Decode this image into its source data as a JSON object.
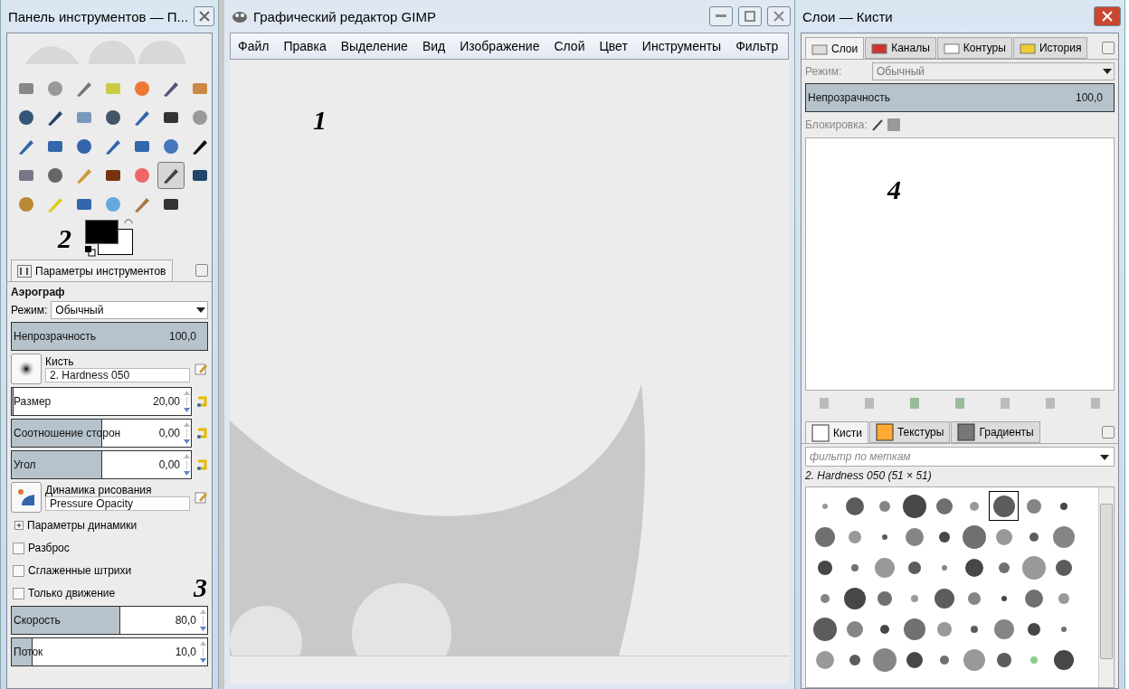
{
  "toolbox": {
    "title": "Панель инструментов — П...",
    "tools": [
      {
        "selected": false
      },
      {
        "selected": false
      },
      {
        "selected": false
      },
      {
        "selected": false
      },
      {
        "selected": false
      },
      {
        "selected": false
      },
      {
        "selected": false
      },
      {
        "selected": false
      },
      {
        "selected": false
      },
      {
        "selected": false
      },
      {
        "selected": false
      },
      {
        "selected": false
      },
      {
        "selected": false
      },
      {
        "selected": false
      },
      {
        "selected": false
      },
      {
        "selected": false
      },
      {
        "selected": false
      },
      {
        "selected": false
      },
      {
        "selected": false
      },
      {
        "selected": false
      },
      {
        "selected": false
      },
      {
        "selected": false
      },
      {
        "selected": false
      },
      {
        "selected": false
      },
      {
        "selected": false
      },
      {
        "selected": false
      },
      {
        "selected": true
      },
      {
        "selected": false
      },
      {
        "selected": false
      },
      {
        "selected": false
      },
      {
        "selected": false
      },
      {
        "selected": false
      },
      {
        "selected": false
      },
      {
        "selected": false
      }
    ],
    "annotation": "2",
    "options_tab": {
      "label": "Параметры инструментов",
      "selected": true
    },
    "tool_name": "Аэрограф",
    "mode": {
      "label": "Режим:",
      "value": "Обычный"
    },
    "opacity": {
      "label": "Непрозрачность",
      "value": "100,0",
      "level": 1
    },
    "brush": {
      "label": "Кисть",
      "value": "2. Hardness 050"
    },
    "brush_sliders": [
      {
        "label": "Размер",
        "value": "20,00",
        "level": 0.005
      },
      {
        "label": "Соотношение сторон",
        "value": "0,00",
        "level": 0.5
      },
      {
        "label": "Угол",
        "value": "0,00",
        "level": 0.5
      }
    ],
    "dynamics": {
      "label": "Динамика рисования",
      "value": "Pressure Opacity"
    },
    "dynamics_options": {
      "label": "Параметры динамики",
      "expanded": false
    },
    "checkboxes": [
      {
        "label": "Разброс",
        "checked": false
      },
      {
        "label": "Сглаженные штрихи",
        "checked": false
      },
      {
        "label": "Только движение",
        "checked": false
      }
    ],
    "annotation_2": "3",
    "rate_sliders": [
      {
        "label": "Скорость",
        "value": "80,0",
        "level": 0.55
      },
      {
        "label": "Поток",
        "value": "10,0",
        "level": 0.1
      }
    ]
  },
  "image_window": {
    "title": "Графический редактор GIMP",
    "menu": [
      "Файл",
      "Правка",
      "Выделение",
      "Вид",
      "Изображение",
      "Слой",
      "Цвет",
      "Инструменты",
      "Фильтр"
    ],
    "annotation": "1"
  },
  "dock": {
    "title": "Слои — Кисти",
    "tabs": [
      {
        "label": "Слои",
        "selected": true
      },
      {
        "label": "Каналы",
        "selected": false
      },
      {
        "label": "Контуры",
        "selected": false
      },
      {
        "label": "История",
        "selected": false
      }
    ],
    "mode": {
      "label": "Режим:",
      "value": "Обычный"
    },
    "opacity": {
      "label": "Непрозрачность",
      "value": "100,0",
      "level": 1
    },
    "lock_label": "Блокировка:",
    "annotation": "4",
    "brush_tabs": [
      {
        "label": "Кисти",
        "selected": true
      },
      {
        "label": "Текстуры",
        "selected": false
      },
      {
        "label": "Градиенты",
        "selected": false
      }
    ],
    "filter": {
      "placeholder": "фильтр по меткам"
    },
    "brush_name": "2. Hardness 050 (51 × 51)",
    "brushes": [
      {
        "selected": false
      },
      {
        "selected": false
      },
      {
        "selected": false
      },
      {
        "selected": false
      },
      {
        "selected": false
      },
      {
        "selected": false
      },
      {
        "selected": true
      },
      {
        "selected": false
      },
      {
        "selected": false
      },
      {
        "selected": false
      },
      {
        "selected": false
      },
      {
        "selected": false
      },
      {
        "selected": false
      },
      {
        "selected": false
      },
      {
        "selected": false
      },
      {
        "selected": false
      },
      {
        "selected": false
      },
      {
        "selected": false
      },
      {
        "selected": false
      },
      {
        "selected": false
      },
      {
        "selected": false
      },
      {
        "selected": false
      },
      {
        "selected": false
      },
      {
        "selected": false
      },
      {
        "selected": false
      },
      {
        "selected": false
      },
      {
        "selected": false
      },
      {
        "selected": false
      },
      {
        "selected": false
      },
      {
        "selected": false
      },
      {
        "selected": false
      },
      {
        "selected": false
      },
      {
        "selected": false
      },
      {
        "selected": false
      },
      {
        "selected": false
      },
      {
        "selected": false
      },
      {
        "selected": false
      },
      {
        "selected": false
      },
      {
        "selected": false
      },
      {
        "selected": false
      },
      {
        "selected": false
      },
      {
        "selected": false
      },
      {
        "selected": false
      },
      {
        "selected": false
      },
      {
        "selected": false
      },
      {
        "selected": false
      },
      {
        "selected": false
      },
      {
        "selected": false
      },
      {
        "selected": false
      },
      {
        "selected": false
      },
      {
        "selected": false
      },
      {
        "selected": false
      },
      {
        "selected": false
      },
      {
        "selected": false
      }
    ]
  }
}
